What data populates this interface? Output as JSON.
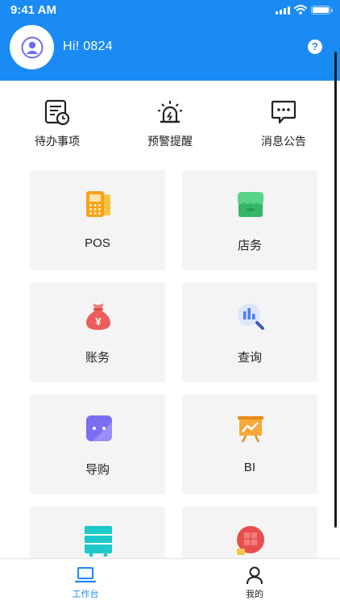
{
  "status_bar": {
    "time": "9:41 AM"
  },
  "header": {
    "greeting": "Hi! 0824",
    "help_label": "?"
  },
  "quick_actions": [
    {
      "label": "待办事项",
      "icon": "todo-clock-icon"
    },
    {
      "label": "预警提醒",
      "icon": "alarm-siren-icon"
    },
    {
      "label": "消息公告",
      "icon": "message-bubble-icon"
    }
  ],
  "modules": [
    {
      "label": "POS",
      "icon": "pos-terminal-icon"
    },
    {
      "label": "店务",
      "icon": "store-icon"
    },
    {
      "label": "账务",
      "icon": "money-bag-icon"
    },
    {
      "label": "查询",
      "icon": "chart-search-icon"
    },
    {
      "label": "导购",
      "icon": "guide-robot-icon"
    },
    {
      "label": "BI",
      "icon": "bi-presentation-icon"
    },
    {
      "label": "",
      "icon": "shelf-cart-icon"
    },
    {
      "label": "",
      "icon": "boxes-icon"
    }
  ],
  "tabbar": [
    {
      "label": "工作台",
      "icon": "laptop-icon",
      "active": true
    },
    {
      "label": "我的",
      "icon": "person-icon",
      "active": false
    }
  ],
  "colors": {
    "primary": "#1a8af5",
    "card_bg": "#f4f4f4",
    "text": "#222222"
  }
}
